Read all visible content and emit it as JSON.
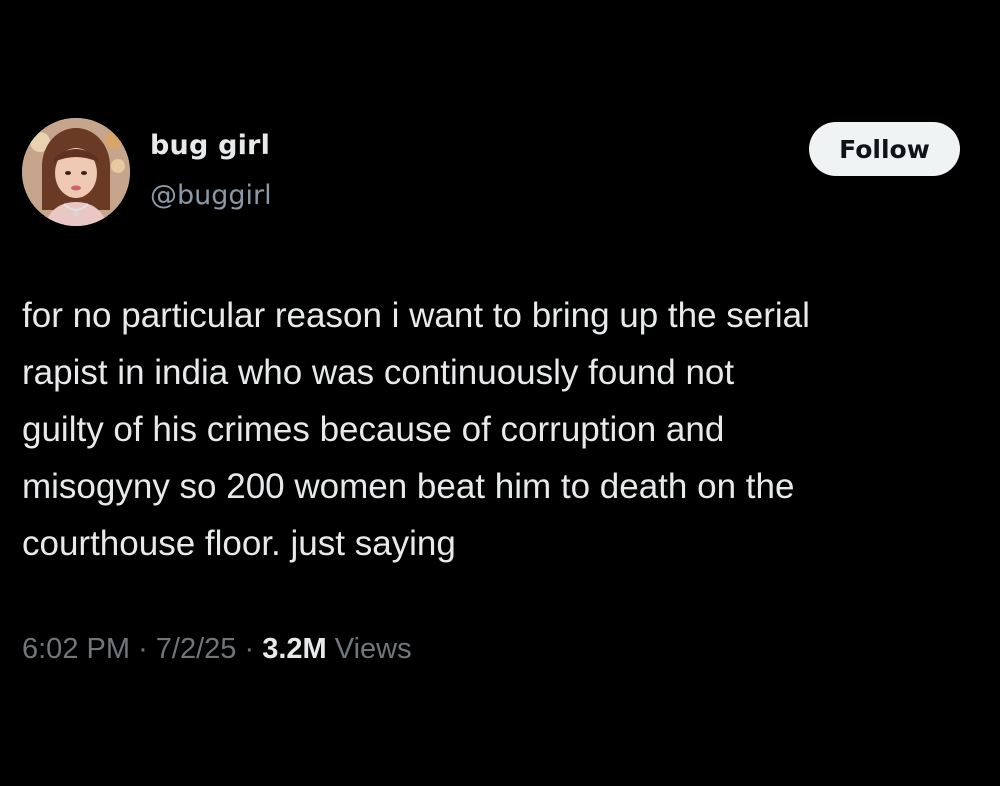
{
  "author": {
    "display_name": "bug girl",
    "handle": "@buggirl",
    "avatar_icon": "profile-photo"
  },
  "follow_label": "Follow",
  "tweet": {
    "lines": [
      "for no particular reason i want to bring up the serial",
      "rapist in india who was continuously found not",
      "guilty of his crimes because of corruption and",
      "misogyny so 200 women beat him to death on the",
      "courthouse floor. just saying"
    ]
  },
  "meta": {
    "time": "6:02 PM",
    "sep1": "·",
    "date": "7/2/25",
    "sep2": "·",
    "views_count": "3.2M",
    "views_label": "Views"
  },
  "colors": {
    "background": "#000000",
    "primary_text": "#e7e9ea",
    "secondary_text": "#71767b",
    "follow_bg": "#eff3f4"
  }
}
